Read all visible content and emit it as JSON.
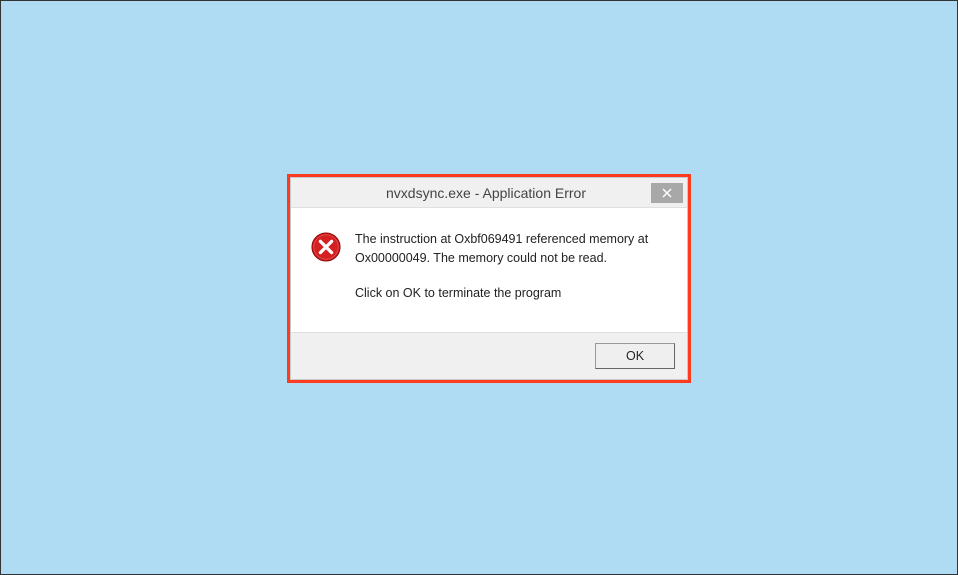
{
  "dialog": {
    "title": "nvxdsync.exe - Application Error",
    "message": {
      "line1": "The instruction at Oxbf069491 referenced memory at Ox00000049. The memory could not be read.",
      "line2": "Click on OK to terminate the program"
    },
    "buttons": {
      "ok": "OK"
    }
  }
}
